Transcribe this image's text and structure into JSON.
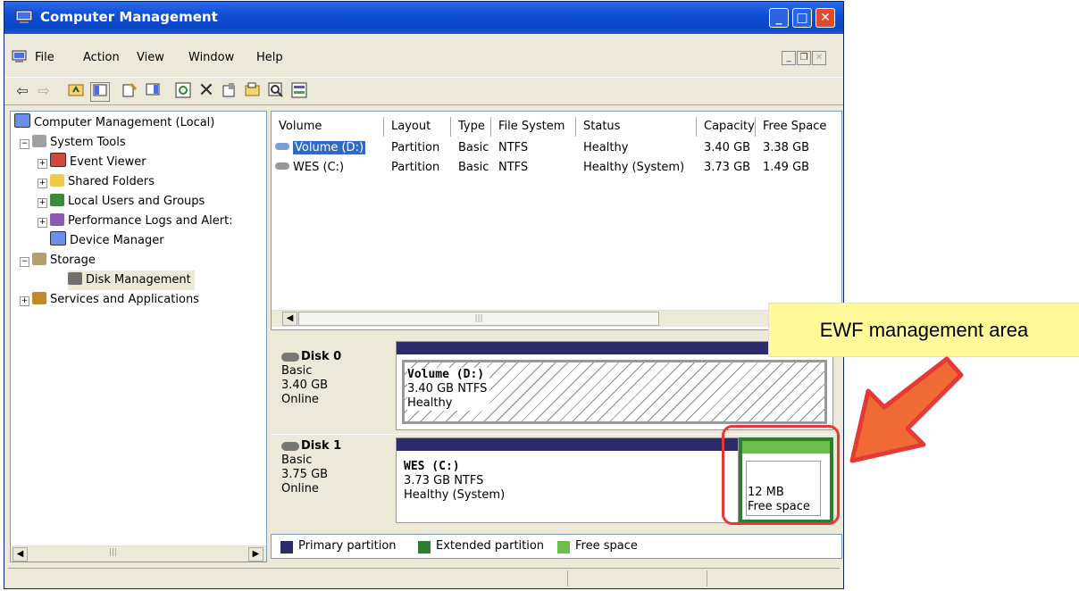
{
  "window": {
    "title": "Computer Management"
  },
  "menu": {
    "items": [
      "File",
      "Action",
      "View",
      "Window",
      "Help"
    ]
  },
  "tree": {
    "root": "Computer Management (Local)",
    "system_tools": "System Tools",
    "event_viewer": "Event Viewer",
    "shared_folders": "Shared Folders",
    "local_users": "Local Users and Groups",
    "perf_logs": "Performance Logs and Alert:",
    "device_manager": "Device Manager",
    "storage": "Storage",
    "disk_management": "Disk Management",
    "services": "Services and Applications"
  },
  "volume_list": {
    "columns": [
      "Volume",
      "Layout",
      "Type",
      "File System",
      "Status",
      "Capacity",
      "Free Space"
    ],
    "rows": [
      [
        "Volume (D:)",
        "Partition",
        "Basic",
        "NTFS",
        "Healthy",
        "3.40 GB",
        "3.38 GB"
      ],
      [
        "WES (C:)",
        "Partition",
        "Basic",
        "NTFS",
        "Healthy (System)",
        "3.73 GB",
        "1.49 GB"
      ]
    ]
  },
  "disks": [
    {
      "name": "Disk 0",
      "type": "Basic",
      "size": "3.40 GB",
      "state": "Online",
      "partition": {
        "name": "Volume  (D:)",
        "detail": "3.40 GB NTFS",
        "status": "Healthy"
      }
    },
    {
      "name": "Disk 1",
      "type": "Basic",
      "size": "3.75 GB",
      "state": "Online",
      "partition": {
        "name": "WES  (C:)",
        "detail": "3.73 GB NTFS",
        "status": "Healthy (System)"
      },
      "free": {
        "size": "12 MB",
        "label": "Free space"
      }
    }
  ],
  "legend": {
    "primary": "Primary partition",
    "extended": "Extended partition",
    "free": "Free space"
  },
  "colors": {
    "primary": "#2c2b6b",
    "extended": "#2e7d32",
    "free": "#6cc04a",
    "annotation": "#e53935"
  },
  "annotation": {
    "label": "EWF management area"
  }
}
